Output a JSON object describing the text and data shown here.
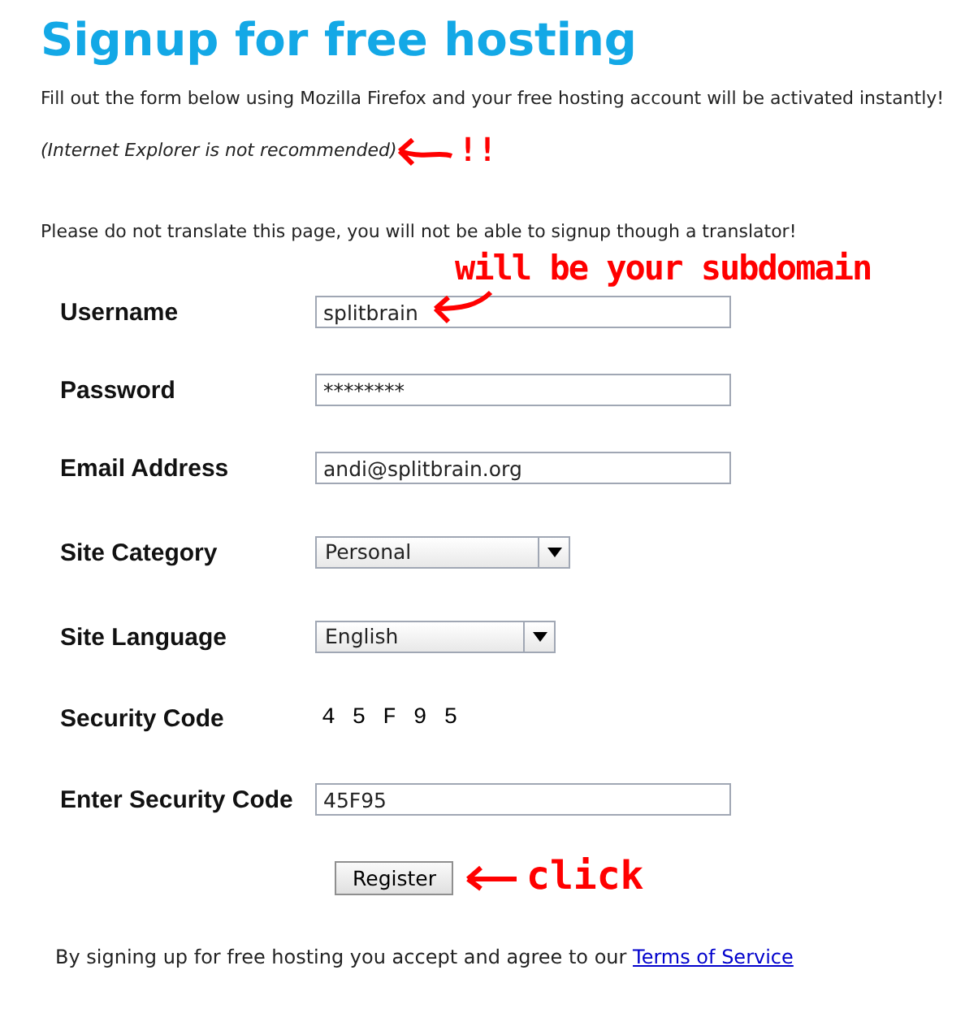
{
  "title": "Signup for free hosting",
  "intro": "Fill out the form below using Mozilla Firefox and your free hosting account will be activated instantly!",
  "browser_note": "(Internet Explorer is not recommended)",
  "translate_note": "Please do not translate this page, you will not be able to signup though a translator!",
  "fields": [
    {
      "kind": "text",
      "label": "Username",
      "value": "splitbrain"
    },
    {
      "kind": "text",
      "label": "Password",
      "value": "********"
    },
    {
      "kind": "text",
      "label": "Email Address",
      "value": "andi@splitbrain.org"
    },
    {
      "kind": "select",
      "label": "Site Category",
      "value": "Personal"
    },
    {
      "kind": "select",
      "label": "Site Language",
      "value": "English"
    },
    {
      "kind": "captcha",
      "label": "Security Code",
      "value": "4 5 F 9 5"
    },
    {
      "kind": "text",
      "label": "Enter Security Code",
      "value": "45F95"
    }
  ],
  "register_button": "Register",
  "footer": {
    "text": "By signing up for free hosting you accept and agree to our ",
    "link": "Terms of Service"
  },
  "annotations": [
    {
      "text": "!!"
    },
    {
      "text": "will be your subdomain"
    },
    {
      "text": "click"
    }
  ]
}
